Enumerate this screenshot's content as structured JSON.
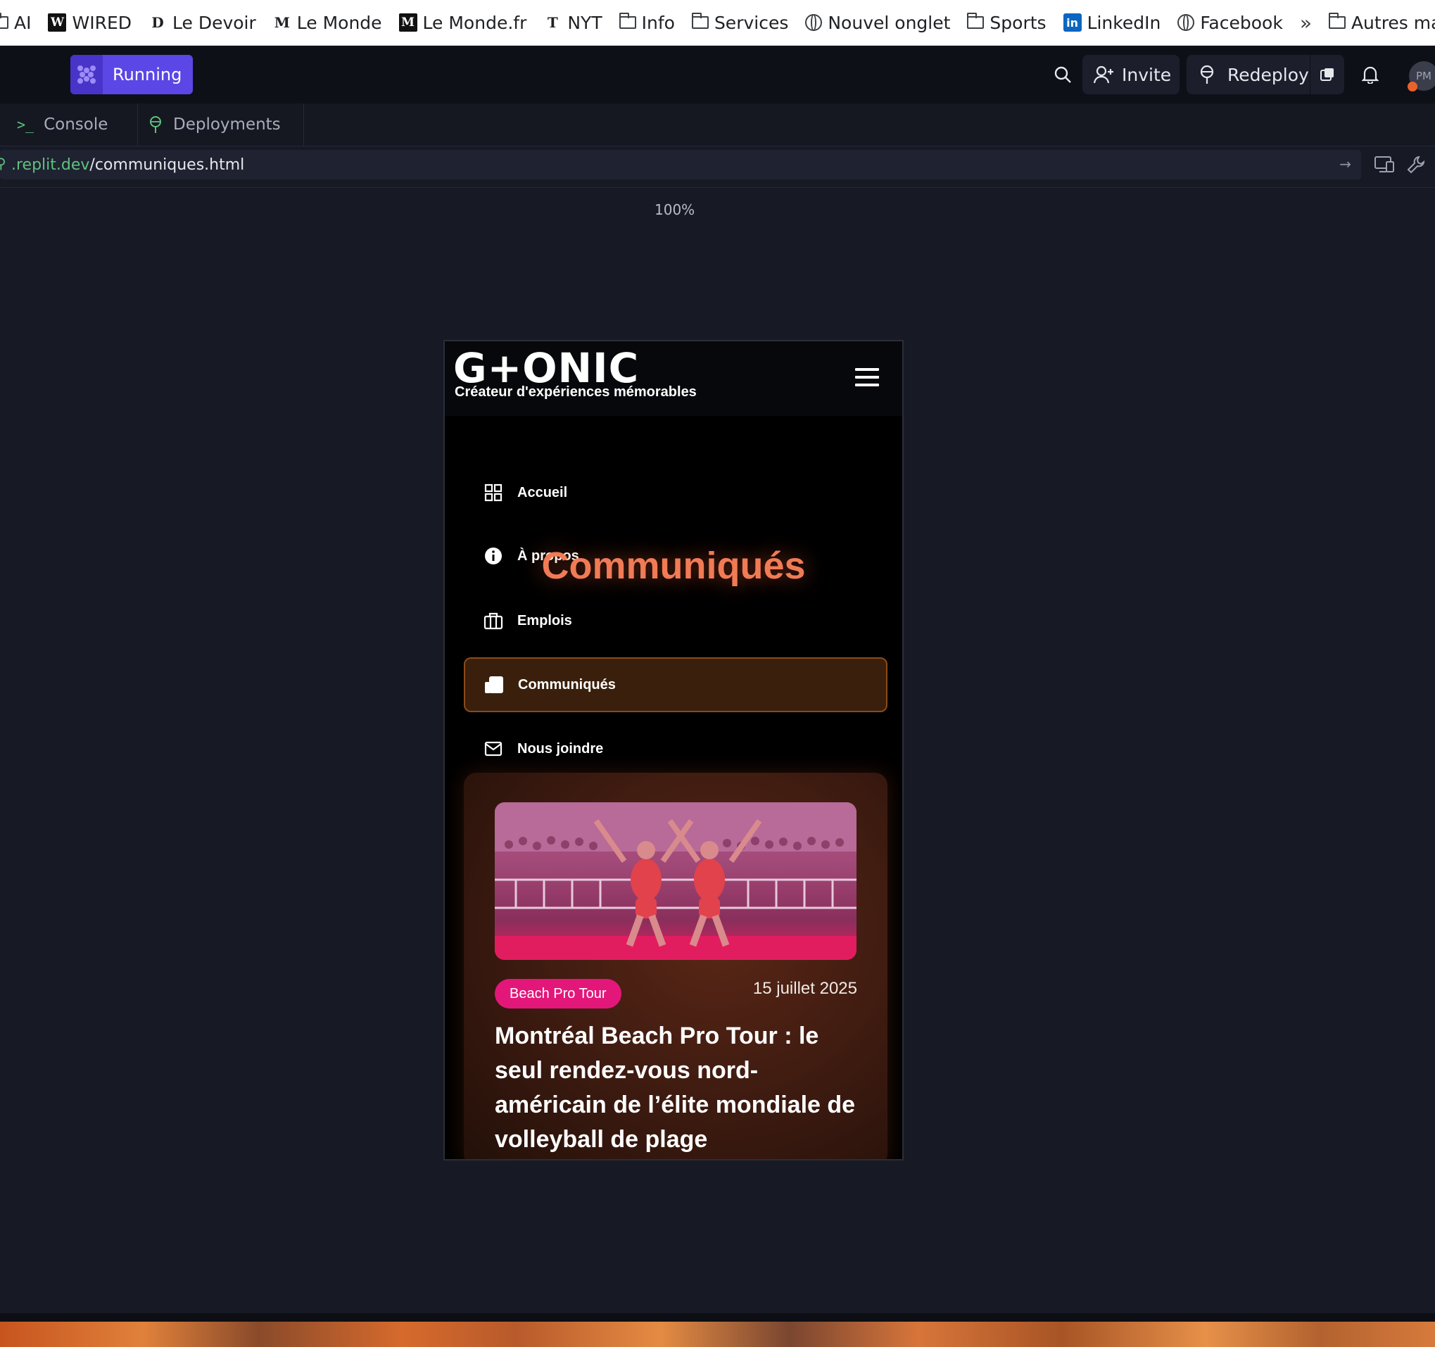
{
  "bookmarks": [
    {
      "label": "AI",
      "icon": "folder-icon"
    },
    {
      "label": "WIRED",
      "icon": "wired-logo-icon"
    },
    {
      "label": "Le Devoir",
      "icon": "le-devoir-logo-icon"
    },
    {
      "label": "Le Monde",
      "icon": "le-monde-logo-icon"
    },
    {
      "label": "Le Monde.fr",
      "icon": "le-monde-fr-logo-icon"
    },
    {
      "label": "NYT",
      "icon": "nyt-logo-icon"
    },
    {
      "label": "Info",
      "icon": "folder-icon"
    },
    {
      "label": "Services",
      "icon": "folder-icon"
    },
    {
      "label": "Nouvel onglet",
      "icon": "globe-icon"
    },
    {
      "label": "Sports",
      "icon": "folder-icon"
    },
    {
      "label": "LinkedIn",
      "icon": "linkedin-icon"
    },
    {
      "label": "Facebook",
      "icon": "globe-icon"
    },
    {
      "label": "Autres marque-pa",
      "icon": "folder-icon"
    }
  ],
  "topbar": {
    "status_label": "Running",
    "invite_label": "Invite",
    "redeploy_label": "Redeploy",
    "avatar_initials": "PM"
  },
  "tabs": [
    {
      "label": "Console",
      "icon": "terminal-icon"
    },
    {
      "label": "Deployments",
      "icon": "deployments-icon"
    }
  ],
  "urlbar": {
    "host": ".replit.dev",
    "path": "/communiques.html"
  },
  "zoom": "100%",
  "site": {
    "logo_text": "G+ONIC",
    "tagline": "Créateur d'expériences mémorables",
    "page_title": "Communiqués",
    "nav": [
      {
        "label": "Accueil",
        "icon": "grid-icon"
      },
      {
        "label": "À propos",
        "icon": "info-icon"
      },
      {
        "label": "Emplois",
        "icon": "briefcase-icon"
      },
      {
        "label": "Communiqués",
        "icon": "newspaper-icon",
        "active": true
      },
      {
        "label": "Nous joindre",
        "icon": "mail-icon"
      }
    ],
    "card": {
      "tag": "Beach Pro Tour",
      "date": "15 juillet 2025",
      "title": "Montréal Beach Pro Tour : le seul rendez-vous nord-américain de l’élite mondiale de volleyball de plage"
    }
  },
  "colors": {
    "accent": "#f07b55",
    "running": "#5b47e6",
    "tag": "#e3177a",
    "url_host": "#5fc27e"
  }
}
